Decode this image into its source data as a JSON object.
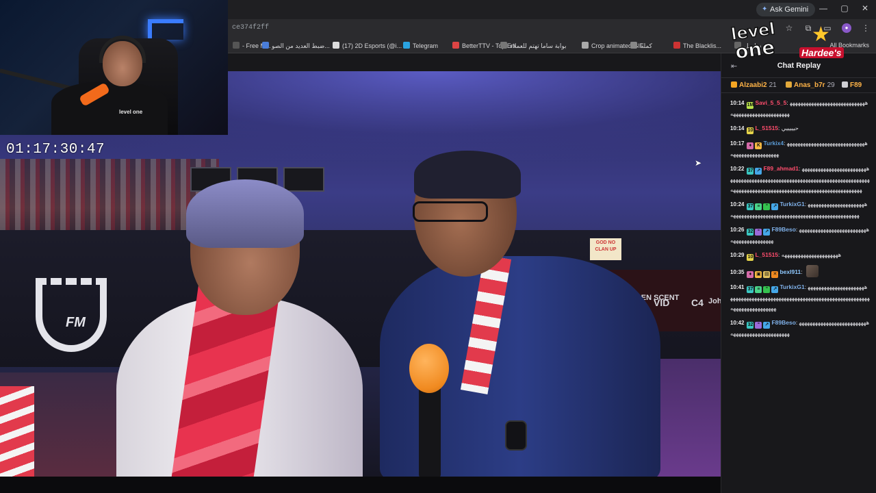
{
  "webcam": {
    "timer": "01:17:30:47",
    "shirt_logo": "level one"
  },
  "browser": {
    "url_fragment": "ce374f2ff",
    "ask_gemini": "Ask Gemini",
    "window_controls": [
      "—",
      "▢",
      "✕"
    ],
    "all_bookmarks": "All Bookmarks",
    "bookmarks": [
      {
        "label": "- Free M...",
        "icon_color": "#555555"
      },
      {
        "label": "ضبط العديد من الصو...",
        "icon_color": "#4a7dd8"
      },
      {
        "label": "(17) 2D Esports (@i...",
        "icon_color": "#dddddd"
      },
      {
        "label": "Telegram",
        "icon_color": "#2aa3e0"
      },
      {
        "label": "BetterTTV - Top Em...",
        "icon_color": "#d44"
      },
      {
        "label": "بوابة ساما تهتم للعملاء",
        "icon_color": "#777777"
      },
      {
        "label": "Crop animated GIF",
        "icon_color": "#aaaaaa"
      },
      {
        "label": "كملنا",
        "icon_color": "#888888"
      },
      {
        "label": "The Blacklis...",
        "icon_color": "#c33"
      },
      {
        "label": "سلسل",
        "icon_color": "#666666"
      }
    ]
  },
  "sponsors": {
    "level_one": [
      "level",
      "one"
    ],
    "hardees": "Hardee's"
  },
  "video": {
    "sign_text": "GOD NO CLAN UP",
    "ufm_text": "FM",
    "sponsors": [
      "GOLDEN SCENT",
      "VID",
      "C4",
      "Joh"
    ]
  },
  "chat": {
    "title": "Chat Replay",
    "leaders": [
      {
        "name": "Alzaabi2",
        "count": "21",
        "badge_color": "#f5a623"
      },
      {
        "name": "Anas_b7r",
        "count": "29",
        "badge_color": "#e2a93b"
      },
      {
        "name": "F89",
        "count": "",
        "badge_color": "#cfcfd4"
      }
    ],
    "messages": [
      {
        "time": "10:14",
        "badges": [
          {
            "c": "#b9e34b",
            "t": "1M"
          }
        ],
        "user": "Savi_5_5_5",
        "user_color": "#ff4d6d",
        "body": "ههههههههههههههههههههههههههههههههههههههههههههههههههه"
      },
      {
        "time": "10:14",
        "badges": [
          {
            "c": "#e5d34a",
            "t": "10"
          }
        ],
        "user": "L_51515",
        "user_color": "#ff4d6d",
        "body": "حيييييي"
      },
      {
        "time": "10:17",
        "badges": [
          {
            "c": "#d46aa8",
            "t": "♦"
          },
          {
            "c": "#f5b942",
            "t": "K"
          }
        ],
        "user": "Turkix4",
        "user_color": "#5b9bd5",
        "body": "هههههههههههههههههههههههههههههههههههههههههههههههه"
      },
      {
        "time": "10:22",
        "badges": [
          {
            "c": "#3ac7c2",
            "t": "37"
          },
          {
            "c": "#45a7e8",
            "t": "↗"
          }
        ],
        "user": "F89_ahmad1",
        "user_color": "#ff4d6d",
        "body": "هههههههههههههههههههههههههههههههههههههههههههههههههههههههههههههههههههههههههههههههههههههههههههههههههههههههههههههههههههههههههههههه"
      },
      {
        "time": "10:24",
        "badges": [
          {
            "c": "#3ac7c2",
            "t": "37"
          },
          {
            "c": "#4ad58a",
            "t": "≡"
          },
          {
            "c": "#35c24f",
            "t": "⁼"
          },
          {
            "c": "#45a7e8",
            "t": "↗"
          }
        ],
        "user": "TurkixG1",
        "user_color": "#7fb0e8",
        "body": "هههههههههههههههههههههههههههههههههههههههههههههههههههههههههههههههههههههه"
      },
      {
        "time": "10:26",
        "badges": [
          {
            "c": "#3ac7c2",
            "t": "32"
          },
          {
            "c": "#9b6ad8",
            "t": "⁼"
          },
          {
            "c": "#45a7e8",
            "t": "↗"
          }
        ],
        "user": "F89Beso",
        "user_color": "#7fb0e8",
        "body": "هههههههههههههههههههههههههههههههههههههههههه"
      },
      {
        "time": "10:29",
        "badges": [
          {
            "c": "#e5d34a",
            "t": "10"
          }
        ],
        "user": "L_51515",
        "user_color": "#ff4d6d",
        "body": "هههههههههههههههههههههه"
      },
      {
        "time": "10:35",
        "badges": [
          {
            "c": "#d46aa8",
            "t": "♦"
          },
          {
            "c": "#f5b942",
            "t": "▣"
          },
          {
            "c": "#e0c060",
            "t": "▤"
          },
          {
            "c": "#f08a20",
            "t": "✕"
          }
        ],
        "user": "bexl911",
        "user_color": "#8fc9ff",
        "body": "",
        "emote": true
      },
      {
        "time": "10:41",
        "badges": [
          {
            "c": "#3ac7c2",
            "t": "37"
          },
          {
            "c": "#4ad58a",
            "t": "≡"
          },
          {
            "c": "#35c24f",
            "t": "⁼"
          },
          {
            "c": "#45a7e8",
            "t": "↗"
          }
        ],
        "user": "TurkixG1",
        "user_color": "#7fb0e8",
        "body": "ههههههههههههههههههههههههههههههههههههههههههههههههههههههههههههههههههههههههههههههههههههههههههه"
      },
      {
        "time": "10:42",
        "badges": [
          {
            "c": "#3ac7c2",
            "t": "32"
          },
          {
            "c": "#9b6ad8",
            "t": "⁼"
          },
          {
            "c": "#45a7e8",
            "t": "↗"
          }
        ],
        "user": "F89Beso",
        "user_color": "#7fb0e8",
        "body": "هههههههههههههههههههههههههههههههههههههههههههههههه"
      }
    ]
  }
}
